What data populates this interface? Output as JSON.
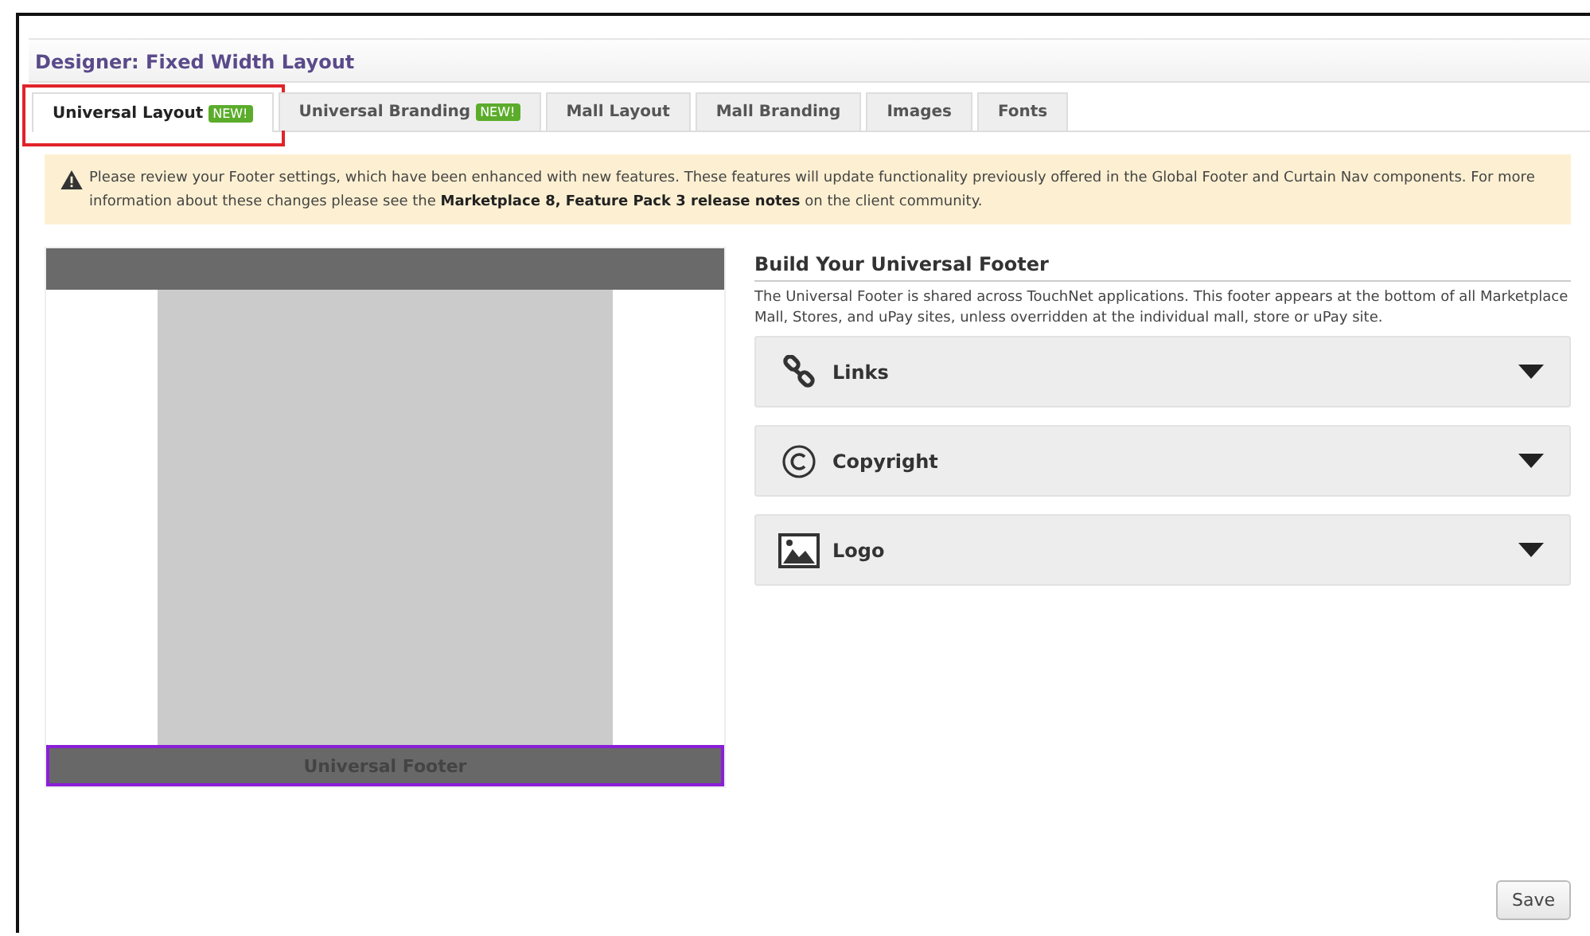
{
  "window": {
    "title": "Designer: Fixed Width Layout"
  },
  "tabs": [
    {
      "label": "Universal Layout",
      "badge": "NEW!",
      "selected": true,
      "highlighted": true
    },
    {
      "label": "Universal Branding",
      "badge": "NEW!",
      "selected": false,
      "highlighted": false
    },
    {
      "label": "Mall Layout",
      "selected": false,
      "highlighted": false
    },
    {
      "label": "Mall Branding",
      "selected": false,
      "highlighted": false
    },
    {
      "label": "Images",
      "selected": false,
      "highlighted": false
    },
    {
      "label": "Fonts",
      "selected": false,
      "highlighted": false
    }
  ],
  "notice": {
    "text": "Please review your Footer settings, which have been enhanced with new features. These features will update functionality previously offered in the Global Footer and Curtain Nav components. For more information about these changes please see the **Marketplace 8, Feature Pack 3 release notes** on the client community."
  },
  "preview": {
    "footer_label": "Universal Footer",
    "footer_selected": true
  },
  "panel": {
    "heading": "Build Your Universal Footer",
    "description": "The Universal Footer is shared across TouchNet applications. This footer appears at the bottom of all Marketplace Mall, Stores, and uPay sites, unless overridden at the individual mall, store or uPay site.",
    "sections": [
      {
        "kind": "links",
        "label": "Links",
        "expanded": false
      },
      {
        "kind": "copyright",
        "label": "Copyright",
        "expanded": false
      },
      {
        "kind": "image",
        "label": "Logo",
        "expanded": false
      }
    ]
  },
  "buttons": [
    {
      "label": "Save"
    }
  ]
}
